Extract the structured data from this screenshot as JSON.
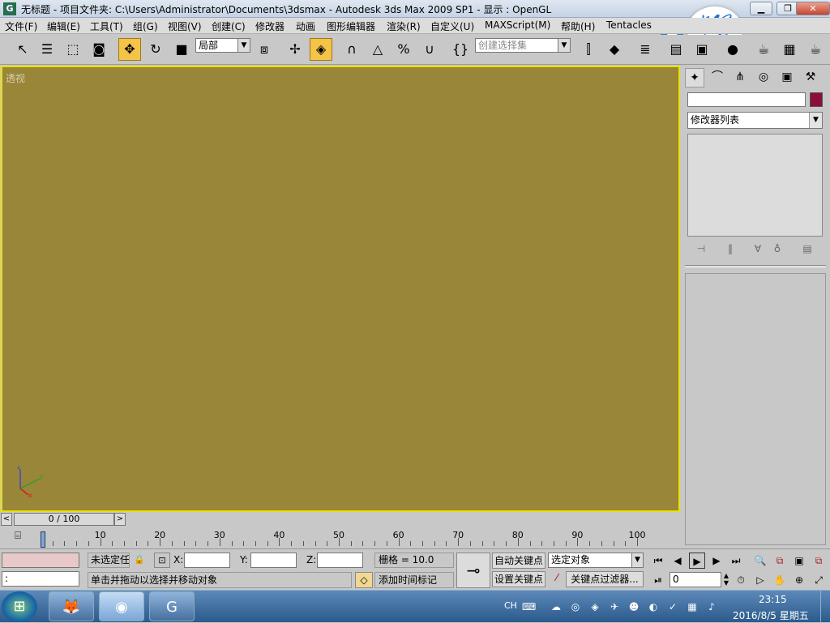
{
  "window": {
    "app_icon": "3ds-max-icon",
    "title": "无标题      - 项目文件夹: C:\\Users\\Administrator\\Documents\\3dsmax        - Autodesk 3ds Max  2009 SP1     - 显示 : OpenGL",
    "minimize": "▁",
    "maximize": "❐",
    "close": "✕"
  },
  "menu": [
    "文件(F)",
    "编辑(E)",
    "工具(T)",
    "组(G)",
    "视图(V)",
    "创建(C)",
    "修改器",
    "动画",
    "图形编辑器",
    "渲染(R)",
    "自定义(U)",
    "MAXScript(M)",
    "帮助(H)",
    "Tentacles"
  ],
  "toolbar": {
    "coord_system": "局部",
    "named_selection_placeholder": "创建选择集"
  },
  "viewport": {
    "label": "透视",
    "accent": "#998639",
    "border": "#e8e100"
  },
  "command_panel": {
    "object_color": "#8b0d3a",
    "modifier_list": "修改器列表"
  },
  "time_slider": {
    "value": "0 / 100",
    "prev": "<",
    "next": ">"
  },
  "trackbar": {
    "ticks": [
      0,
      10,
      20,
      30,
      40,
      50,
      60,
      70,
      80,
      90,
      100
    ]
  },
  "status": {
    "selection": "未选定任",
    "x_label": "X:",
    "y_label": "Y:",
    "z_label": "Z:",
    "grid": "栅格 = 10.0",
    "prompt": "单击并拖动以选择并移动对象",
    "add_time_tag": "添加时间标记",
    "auto_key": "自动关键点",
    "set_key": "设置关键点",
    "key_mode_select": "选定对象",
    "key_filters": "关键点过滤器...",
    "frame": "0",
    "script_listener": ":"
  },
  "taskbar": {
    "lang": "CH",
    "time": "23:15",
    "date": "2016/8/5 星期五"
  }
}
